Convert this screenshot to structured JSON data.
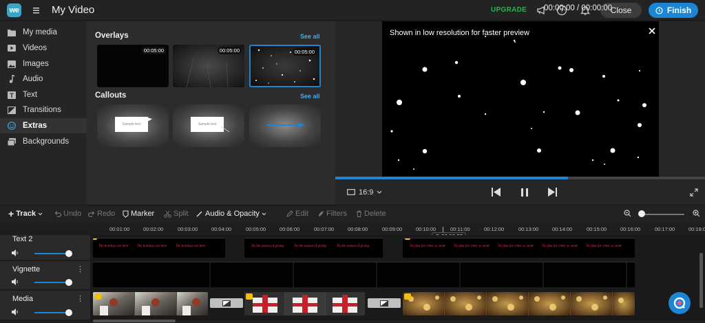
{
  "header": {
    "logo_text": "we",
    "title": "My Video",
    "upgrade_label": "UPGRADE",
    "close_label": "Close",
    "finish_label": "Finish"
  },
  "sidebar": {
    "items": [
      {
        "label": "My media",
        "icon": "folder-icon"
      },
      {
        "label": "Videos",
        "icon": "video-icon"
      },
      {
        "label": "Images",
        "icon": "image-icon"
      },
      {
        "label": "Audio",
        "icon": "music-note-icon"
      },
      {
        "label": "Text",
        "icon": "text-icon"
      },
      {
        "label": "Transitions",
        "icon": "transition-icon"
      },
      {
        "label": "Extras",
        "icon": "smiley-icon",
        "active": true
      },
      {
        "label": "Backgrounds",
        "icon": "backgrounds-icon"
      }
    ]
  },
  "panel": {
    "overlays": {
      "title": "Overlays",
      "see_all": "See all",
      "items": [
        {
          "duration": "00:05:00"
        },
        {
          "duration": "00:05:00"
        },
        {
          "duration": "00:05:00",
          "selected": true
        }
      ]
    },
    "callouts": {
      "title": "Callouts",
      "see_all": "See all",
      "items": [
        {
          "text": "Sample text"
        },
        {
          "text": "Sample text"
        },
        {
          "text": ""
        }
      ]
    }
  },
  "preview": {
    "notice": "Shown in low resolution for faster preview",
    "progress": 0.63,
    "aspect_ratio": "16:9"
  },
  "toolbar": {
    "track": "Track",
    "undo": "Undo",
    "redo": "Redo",
    "marker": "Marker",
    "split": "Split",
    "audio_opacity": "Audio & Opacity",
    "edit": "Edit",
    "filters": "Filters",
    "delete": "Delete",
    "time": "00:00:00 / 00:00:00"
  },
  "timeline": {
    "ruler": [
      "00:01:00",
      "00:02:00",
      "00:03:00",
      "00:04:00",
      "00:05:00",
      "00:06:00",
      "00:07:00",
      "00:08:00",
      "00:09:00",
      "00:10:00",
      "00:11:00",
      "00:12:00",
      "00:13:00",
      "00:14:00",
      "00:15:00",
      "00:16:00",
      "00:17:00",
      "00:18:0"
    ],
    "playhead": "00:06:22",
    "tracks": [
      {
        "name": "Text 2",
        "volume": 1.0
      },
      {
        "name": "Vignette",
        "volume": 1.0
      },
      {
        "name": "Media",
        "volume": 1.0
      }
    ],
    "text_fragments": [
      "The holidays are here",
      "'Tis the season of giving",
      "Tis the season of giving",
      "Tis the season of giving",
      "Tis time for cheer so send",
      "Tis time for cheer so send",
      "Tis time for cheer so send"
    ]
  },
  "colors": {
    "accent": "#1d86d4",
    "upgrade": "#27b54a",
    "text_clip_font": "#e0405a"
  }
}
